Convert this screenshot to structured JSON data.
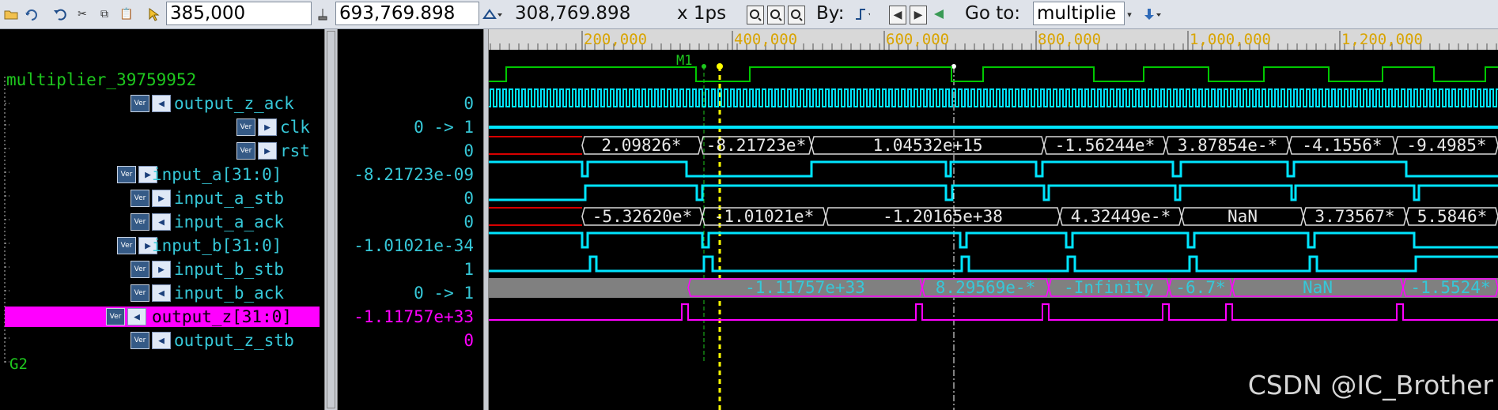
{
  "toolbar": {
    "cursor_time": "385,000",
    "marker_time": "693,769.898",
    "delta_time": "308,769.898",
    "scale": "x 1ps",
    "by_label": "By:",
    "goto_label": "Go to:",
    "goto_value": "multiplie"
  },
  "ruler": {
    "ticks": [
      "200,000",
      "400,000",
      "600,000",
      "800,000",
      "1,000,000",
      "1,200,000"
    ],
    "marker_label": "M1"
  },
  "tree": {
    "root": "multiplier_39759952",
    "group": "G2"
  },
  "signals": [
    {
      "name": "output_z_ack",
      "value": "0"
    },
    {
      "name": "clk",
      "value": "0 -> 1"
    },
    {
      "name": "rst",
      "value": "0"
    },
    {
      "name": "input_a[31:0]",
      "value": "-8.21723e-09"
    },
    {
      "name": "input_a_stb",
      "value": "0"
    },
    {
      "name": "input_a_ack",
      "value": "0"
    },
    {
      "name": "input_b[31:0]",
      "value": "-1.01021e-34"
    },
    {
      "name": "input_b_stb",
      "value": "1"
    },
    {
      "name": "input_b_ack",
      "value": "0 -> 1"
    },
    {
      "name": "output_z[31:0]",
      "value": "-1.11757e+33"
    },
    {
      "name": "output_z_stb",
      "value": "0"
    }
  ],
  "buses": {
    "input_a": [
      "2.09826*",
      "-8.21723e*",
      "1.04532e+15",
      "-1.56244e*",
      "3.87854e-*",
      "-4.1556*",
      "-9.4985*"
    ],
    "input_b": [
      "-5.32620e*",
      "-1.01021e*",
      "-1.20165e+38",
      "4.32449e-*",
      "NaN",
      "3.73567*",
      "5.5846*"
    ],
    "output_z": [
      "-1.11757e+33",
      "8.29569e-*",
      "-Infinity",
      "-6.7*",
      "NaN",
      "-1.5524*"
    ]
  },
  "badge_text": "Ver",
  "watermark": "CSDN @IC_Brother",
  "colors": {
    "signal_text": "#36c8d8",
    "digital_wave": "#00c800",
    "bus_outline": "#d8d8d8",
    "bus_red": "#d80000",
    "cyan_wave": "#00e5ff",
    "magenta": "#ff00ff",
    "cursor": "#ffff00",
    "green": "#1ec81e"
  },
  "icons": [
    "open-icon",
    "reload-icon",
    "undo-icon",
    "cut-icon",
    "copy-icon",
    "paste-icon",
    "cursor-icon",
    "marker-icon",
    "delta-icon",
    "zoom-in-icon",
    "zoom-out-icon",
    "zoom-full-icon",
    "edge-icon",
    "prev-icon",
    "next-icon",
    "back-icon",
    "nav-icon"
  ]
}
